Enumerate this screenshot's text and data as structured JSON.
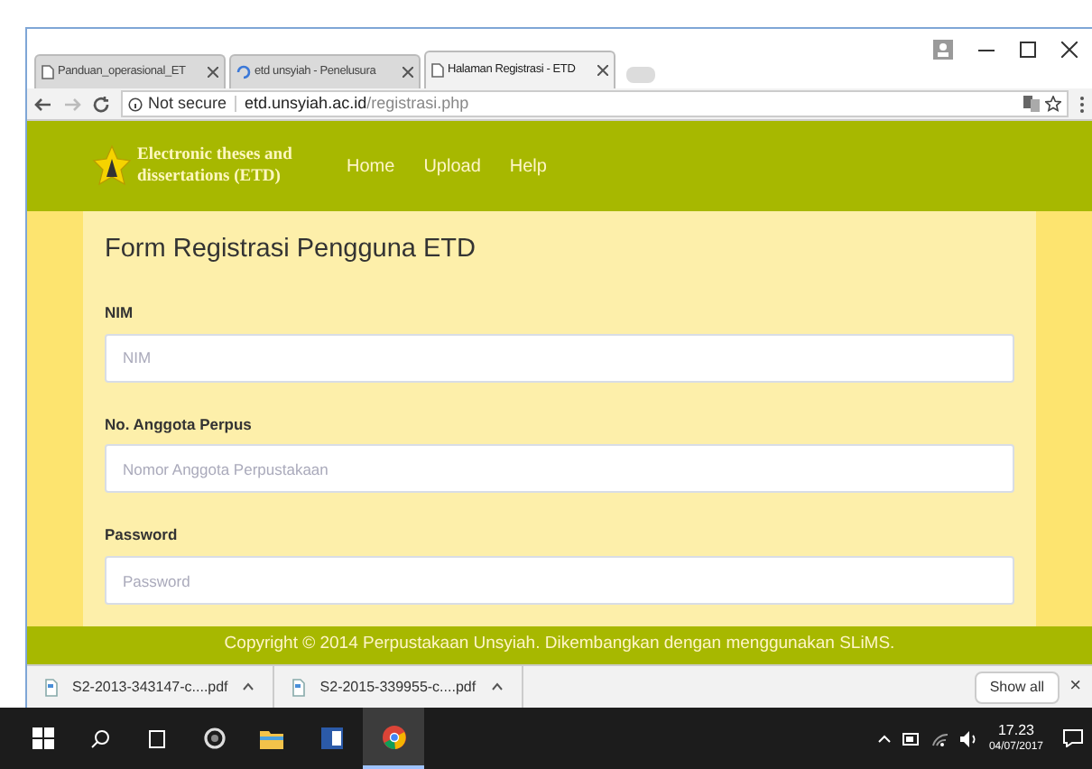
{
  "browser": {
    "tabs": [
      {
        "title": "Panduan_operasional_ET",
        "kind": "page",
        "selected": false
      },
      {
        "title": "etd unsyiah - Penelusura",
        "kind": "loading",
        "selected": false
      },
      {
        "title": "Halaman Registrasi - ETD",
        "kind": "page",
        "selected": true
      }
    ],
    "security": "Not secure",
    "url_host": "etd.unsyiah.ac.id",
    "url_path": "/registrasi.php"
  },
  "site": {
    "logo_text": "Electronic theses and dissertations (ETD)",
    "nav": [
      "Home",
      "Upload",
      "Help"
    ],
    "form": {
      "title": "Form Registrasi Pengguna ETD",
      "fields": [
        {
          "label": "NIM",
          "placeholder": "NIM"
        },
        {
          "label": "No. Anggota Perpus",
          "placeholder": "Nomor Anggota Perpustakaan"
        },
        {
          "label": "Password",
          "placeholder": "Password"
        }
      ]
    },
    "footer": "Copyright © 2014 Perpustakaan Unsyiah. Dikembangkan dengan menggunakan SLiMS."
  },
  "downloads": {
    "items": [
      "S2-2013-343147-c....pdf",
      "S2-2015-339955-c....pdf"
    ],
    "show_all": "Show all",
    "close": "×"
  },
  "taskbar": {
    "apps": [
      {
        "kind": "folder",
        "selected": false
      },
      {
        "kind": "word",
        "selected": false
      },
      {
        "kind": "chrome",
        "selected": true
      }
    ],
    "time": "17.23",
    "date": "04/07/2017"
  }
}
